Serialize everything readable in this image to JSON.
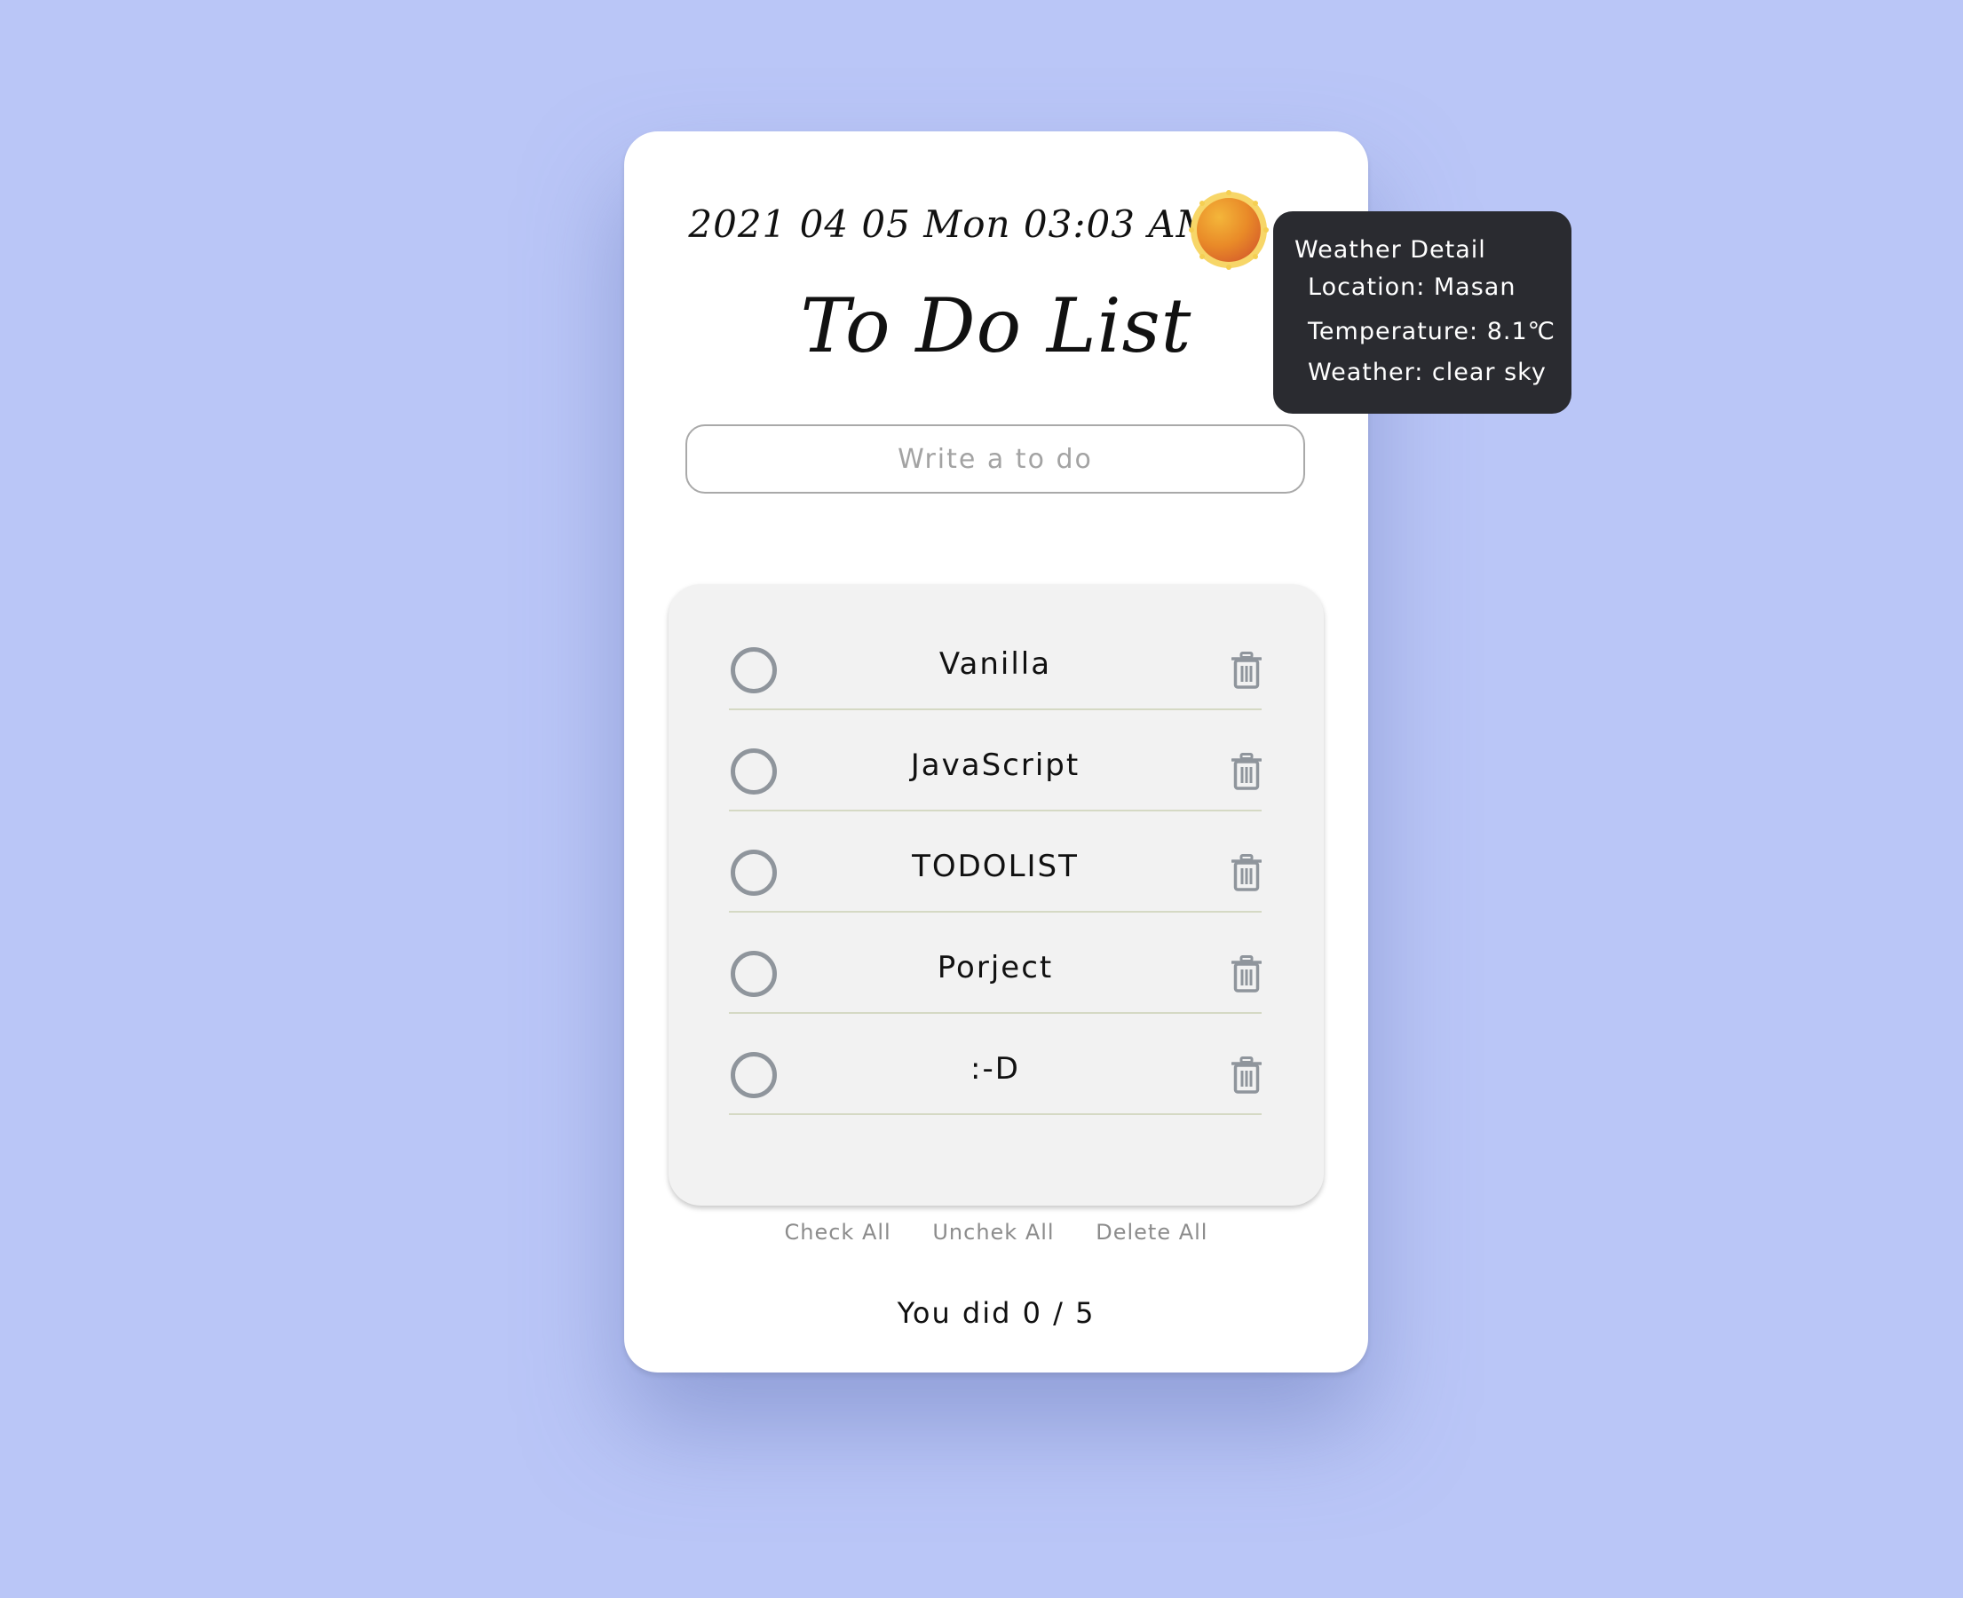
{
  "header": {
    "datetime": "2021 04 05 Mon 03:03 AM",
    "title": "To Do List",
    "weather_icon": "sun-icon"
  },
  "input": {
    "placeholder": "Write a to do",
    "value": ""
  },
  "todos": [
    {
      "label": "Vanilla",
      "done": false
    },
    {
      "label": "JavaScript",
      "done": false
    },
    {
      "label": "TODOLIST",
      "done": false
    },
    {
      "label": "Porject",
      "done": false
    },
    {
      "label": ":-D",
      "done": false
    }
  ],
  "actions": {
    "check_all": "Check All",
    "uncheck_all": "Unchek All",
    "delete_all": "Delete All"
  },
  "progress": {
    "text": "You did 0 / 5"
  },
  "weather_tooltip": {
    "title": "Weather Detail",
    "location": "Location: Masan",
    "temperature": "Temperature: 8.1℃",
    "weather": "Weather: clear sky"
  },
  "colors": {
    "background": "#bac6f7",
    "card": "#ffffff",
    "panel": "#f2f2f2",
    "tooltip": "#2a2b30",
    "icon_gray": "#8f959c"
  }
}
